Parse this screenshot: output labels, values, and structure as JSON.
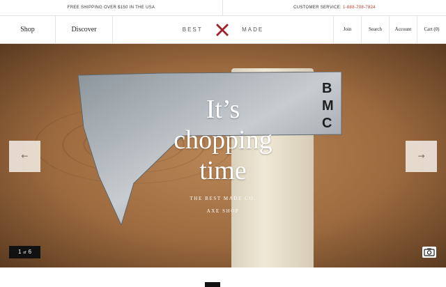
{
  "topbar": {
    "shipping": "FREE SHIPPING OVER $150 IN THE USA",
    "service_label": "CUSTOMER SERVICE:",
    "service_phone": "1-888-708-7824"
  },
  "nav": {
    "shop": "Shop",
    "discover": "Discover",
    "brand_left": "BEST",
    "brand_right": "MADE",
    "join": "Join",
    "search": "Search",
    "account": "Account",
    "cart": "Cart (0)"
  },
  "hero": {
    "title_line1": "It’s",
    "title_line2": "chopping",
    "title_line3": "time",
    "subtitle_line1": "THE BEST MADE CO.",
    "subtitle_line2": "AXE SHOP",
    "blade_stamp": "BMC",
    "slide_current": "1",
    "slide_of": "of",
    "slide_total": "6",
    "prev_glyph": "←",
    "next_glyph": "→"
  },
  "colors": {
    "brand_x": "#a3202a",
    "phone": "#c0392b"
  }
}
